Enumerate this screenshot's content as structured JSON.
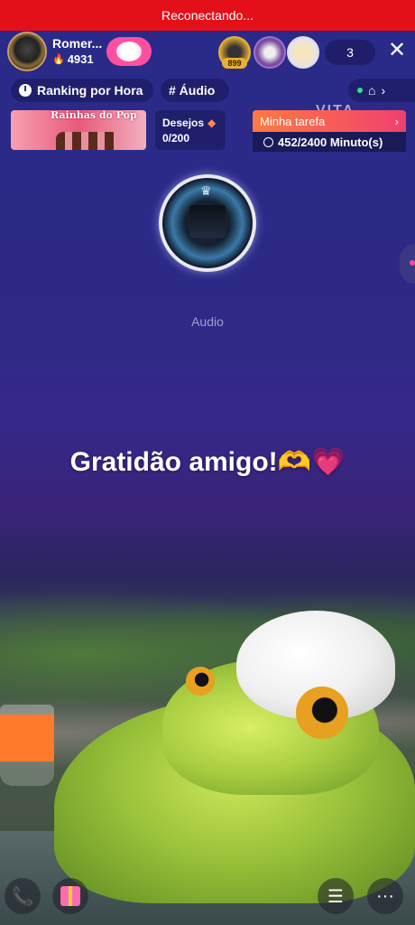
{
  "status_banner": {
    "text": "Reconectando..."
  },
  "host": {
    "name": "Romer...",
    "score": "4931"
  },
  "top_viewers": [
    {
      "badge": "899"
    },
    {
      "badge": ""
    },
    {
      "badge": ""
    }
  ],
  "viewer_count": "3",
  "close_label": "✕",
  "chips": {
    "ranking": "Ranking por Hora",
    "audio_tag": "# Áudio"
  },
  "watermark": "VITA",
  "banner_card": {
    "text": "Rainhas do Pop"
  },
  "wishes": {
    "label": "Desejos",
    "value": "0/200"
  },
  "task": {
    "label": "Minha tarefa",
    "progress": "452/2400 Minuto(s)"
  },
  "room": {
    "label": "Audio"
  },
  "caption": {
    "text": "Gratidão amigo!",
    "emoji_hands": "🫶",
    "emoji_heart": "💗"
  },
  "bottom_bar": {
    "call": "📞",
    "menu": "☰",
    "more": "···"
  }
}
